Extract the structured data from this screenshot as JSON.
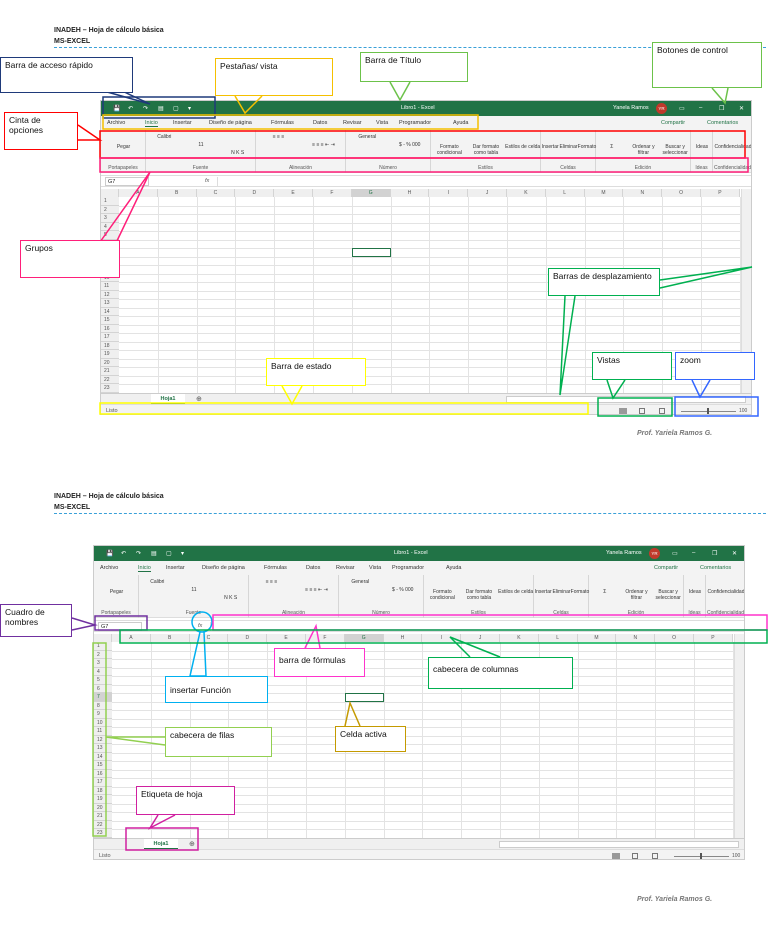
{
  "header": {
    "line1": "INADEH – Hoja de cálculo básica",
    "line2": "MS-EXCEL"
  },
  "footer": "Prof. Yariela Ramos G.",
  "excel": {
    "title": "Libro1 - Excel",
    "user": "Yanela Ramos",
    "user_initials": "YR",
    "window_controls": [
      "▭",
      "–",
      "❐",
      "✕"
    ],
    "qat": [
      "💾",
      "↶",
      "↷",
      "▤",
      "▢",
      "▾"
    ],
    "tabs": [
      "Archivo",
      "Inicio",
      "Insertar",
      "Diseño de página",
      "Fórmulas",
      "Datos",
      "Revisar",
      "Vista",
      "Programador",
      "Ayuda"
    ],
    "share": "Compartir",
    "comments": "Comentarios",
    "groups": [
      {
        "label": "Portapapeles",
        "cmds": [
          "Pegar"
        ]
      },
      {
        "label": "Fuente",
        "cmds": [
          "Calibri",
          "11",
          "N  K  S"
        ]
      },
      {
        "label": "Alineación",
        "cmds": [
          "≡ ≡ ≡",
          "≡ ≡ ≡ ⇤ ⇥"
        ]
      },
      {
        "label": "Número",
        "cmds": [
          "General",
          "$ - % 000"
        ]
      },
      {
        "label": "Estilos",
        "cmds": [
          "Formato condicional",
          "Dar formato como tabla",
          "Estilos de celda"
        ]
      },
      {
        "label": "Celdas",
        "cmds": [
          "Insertar",
          "Eliminar",
          "Formato"
        ]
      },
      {
        "label": "Edición",
        "cmds": [
          "Σ",
          "Ordenar y filtrar",
          "Buscar y seleccionar"
        ]
      },
      {
        "label": "Ideas",
        "cmds": [
          "Ideas"
        ]
      },
      {
        "label": "Confidencialidad",
        "cmds": [
          "Confidencialidad"
        ]
      }
    ],
    "name_box": "G7",
    "fx": "fx",
    "columns": [
      "A",
      "B",
      "C",
      "D",
      "E",
      "F",
      "G",
      "H",
      "I",
      "J",
      "K",
      "L",
      "M",
      "N",
      "O",
      "P"
    ],
    "rows": [
      "1",
      "2",
      "3",
      "4",
      "5",
      "6",
      "7",
      "8",
      "9",
      "10",
      "11",
      "12",
      "13",
      "14",
      "15",
      "16",
      "17",
      "18",
      "19",
      "20",
      "21",
      "22",
      "23"
    ],
    "active_cell": {
      "col": "G",
      "row": "7"
    },
    "sheet": "Hoja1",
    "add_sheet": "⊕",
    "status": "Listo",
    "zoom": "100 %"
  },
  "callouts1": {
    "qat": "Barra de acceso rápido",
    "tabs": "Pestañas/ vista",
    "title": "Barra de Título",
    "controls": "Botones de control",
    "ribbon": "Cinta de opciones",
    "groups": "Grupos",
    "scroll": "Barras de desplazamiento",
    "status": "Barra de estado",
    "views": "Vistas",
    "zoom": "zoom"
  },
  "callouts2": {
    "namebox": "Cuadro de nombres",
    "fx": "insertar Función",
    "formula": "barra de fórmulas",
    "colhdr": "cabecera de columnas",
    "rowhdr": "cabecera de filas",
    "active": "Celda activa",
    "sheet": "Etiqueta de hoja"
  }
}
